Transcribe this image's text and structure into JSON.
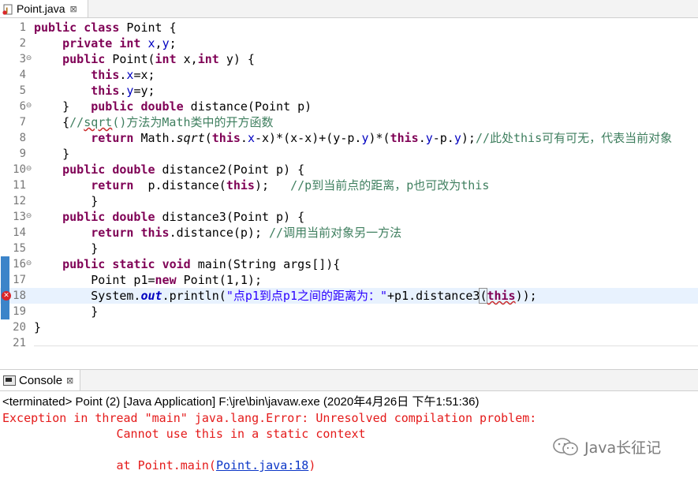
{
  "editor_tab": {
    "title": "Point.java",
    "close": "⊠"
  },
  "code_lines": [
    {
      "n": "1",
      "fold": "",
      "marker": "",
      "current": false,
      "tokens": [
        [
          "kw",
          "public"
        ],
        [
          "",
          " "
        ],
        [
          "kw",
          "class"
        ],
        [
          "",
          " Point {"
        ]
      ]
    },
    {
      "n": "2",
      "fold": "",
      "marker": "",
      "current": false,
      "tokens": [
        [
          "",
          "    "
        ],
        [
          "kw",
          "private"
        ],
        [
          "",
          " "
        ],
        [
          "kw",
          "int"
        ],
        [
          "",
          " "
        ],
        [
          "fld",
          "x"
        ],
        [
          "",
          ","
        ],
        [
          "fld",
          "y"
        ],
        [
          "",
          ";"
        ]
      ]
    },
    {
      "n": "3",
      "fold": "⊖",
      "marker": "",
      "current": false,
      "tokens": [
        [
          "",
          "    "
        ],
        [
          "kw",
          "public"
        ],
        [
          "",
          " Point("
        ],
        [
          "kw",
          "int"
        ],
        [
          "",
          " x,"
        ],
        [
          "kw",
          "int"
        ],
        [
          "",
          " y) {"
        ]
      ]
    },
    {
      "n": "4",
      "fold": "",
      "marker": "",
      "current": false,
      "tokens": [
        [
          "",
          "        "
        ],
        [
          "kw",
          "this"
        ],
        [
          "",
          "."
        ],
        [
          "fld",
          "x"
        ],
        [
          "",
          "=x;"
        ]
      ]
    },
    {
      "n": "5",
      "fold": "",
      "marker": "",
      "current": false,
      "tokens": [
        [
          "",
          "        "
        ],
        [
          "kw",
          "this"
        ],
        [
          "",
          "."
        ],
        [
          "fld",
          "y"
        ],
        [
          "",
          "=y;"
        ]
      ]
    },
    {
      "n": "6",
      "fold": "⊖",
      "marker": "",
      "current": false,
      "tokens": [
        [
          "",
          "    }   "
        ],
        [
          "kw",
          "public"
        ],
        [
          "",
          " "
        ],
        [
          "kw",
          "double"
        ],
        [
          "",
          " distance(Point p)"
        ]
      ]
    },
    {
      "n": "7",
      "fold": "",
      "marker": "",
      "current": false,
      "tokens": [
        [
          "",
          "    {"
        ],
        [
          "cmt",
          "//"
        ],
        [
          "cmt sq",
          "sqrt"
        ],
        [
          "cmt",
          "()方法为Math类中的开方函数"
        ]
      ]
    },
    {
      "n": "8",
      "fold": "",
      "marker": "",
      "current": false,
      "tokens": [
        [
          "",
          "        "
        ],
        [
          "kw",
          "return"
        ],
        [
          "",
          " Math."
        ],
        [
          "ital",
          "sqrt"
        ],
        [
          "",
          "("
        ],
        [
          "kw",
          "this"
        ],
        [
          "",
          "."
        ],
        [
          "fld",
          "x"
        ],
        [
          "",
          "-x)*(x-x)+(y-p."
        ],
        [
          "fld",
          "y"
        ],
        [
          "",
          ")*("
        ],
        [
          "kw",
          "this"
        ],
        [
          "",
          "."
        ],
        [
          "fld",
          "y"
        ],
        [
          "",
          "-p."
        ],
        [
          "fld",
          "y"
        ],
        [
          "",
          ");"
        ],
        [
          "cmt",
          "//此处this可有可无，代表当前对象"
        ]
      ]
    },
    {
      "n": "9",
      "fold": "",
      "marker": "",
      "current": false,
      "tokens": [
        [
          "",
          "    }"
        ]
      ]
    },
    {
      "n": "10",
      "fold": "⊖",
      "marker": "",
      "current": false,
      "tokens": [
        [
          "",
          "    "
        ],
        [
          "kw",
          "public"
        ],
        [
          "",
          " "
        ],
        [
          "kw",
          "double"
        ],
        [
          "",
          " distance2(Point p) {"
        ]
      ]
    },
    {
      "n": "11",
      "fold": "",
      "marker": "",
      "current": false,
      "tokens": [
        [
          "",
          "        "
        ],
        [
          "kw",
          "return"
        ],
        [
          "",
          "  p.distance("
        ],
        [
          "kw",
          "this"
        ],
        [
          "",
          ");   "
        ],
        [
          "cmt",
          "//p到当前点的距离，p也可改为this"
        ]
      ]
    },
    {
      "n": "12",
      "fold": "",
      "marker": "",
      "current": false,
      "tokens": [
        [
          "",
          "        }"
        ]
      ]
    },
    {
      "n": "13",
      "fold": "⊖",
      "marker": "",
      "current": false,
      "tokens": [
        [
          "",
          "    "
        ],
        [
          "kw",
          "public"
        ],
        [
          "",
          " "
        ],
        [
          "kw",
          "double"
        ],
        [
          "",
          " distance3(Point p) {"
        ]
      ]
    },
    {
      "n": "14",
      "fold": "",
      "marker": "",
      "current": false,
      "tokens": [
        [
          "",
          "        "
        ],
        [
          "kw",
          "return"
        ],
        [
          "",
          " "
        ],
        [
          "kw",
          "this"
        ],
        [
          "",
          ".distance(p); "
        ],
        [
          "cmt",
          "//调用当前对象另一方法"
        ]
      ]
    },
    {
      "n": "15",
      "fold": "",
      "marker": "",
      "current": false,
      "tokens": [
        [
          "",
          "        }"
        ]
      ]
    },
    {
      "n": "16",
      "fold": "⊖",
      "marker": "blue",
      "current": false,
      "tokens": [
        [
          "",
          "    "
        ],
        [
          "kw",
          "public"
        ],
        [
          "",
          " "
        ],
        [
          "kw",
          "static"
        ],
        [
          "",
          " "
        ],
        [
          "kw",
          "void"
        ],
        [
          "",
          " main(String args[]){"
        ]
      ]
    },
    {
      "n": "17",
      "fold": "",
      "marker": "blue",
      "current": false,
      "tokens": [
        [
          "",
          "        Point p1="
        ],
        [
          "kw",
          "new"
        ],
        [
          "",
          " Point(1,1);"
        ]
      ]
    },
    {
      "n": "18",
      "fold": "",
      "marker": "error",
      "current": true,
      "tokens": [
        [
          "",
          "        System."
        ],
        [
          "sfld",
          "out"
        ],
        [
          "",
          ".println("
        ],
        [
          "str",
          "\"点p1到点p1之间的距离为：\""
        ],
        [
          "",
          "+p1.distance3"
        ],
        [
          "brk",
          "("
        ],
        [
          "kw sq",
          "this"
        ],
        [
          "",
          "));"
        ]
      ]
    },
    {
      "n": "19",
      "fold": "",
      "marker": "blue",
      "current": false,
      "tokens": [
        [
          "",
          "        }"
        ]
      ]
    },
    {
      "n": "20",
      "fold": "",
      "marker": "",
      "current": false,
      "tokens": [
        [
          "",
          "}"
        ]
      ]
    },
    {
      "n": "21",
      "fold": "",
      "marker": "",
      "current": false,
      "tokens": []
    }
  ],
  "hscroll": {
    "left_arrow": "<"
  },
  "console": {
    "tab_label": "Console",
    "close": "⊠",
    "status": "<terminated> Point (2) [Java Application] F:\\jre\\bin\\javaw.exe (2020年4月26日 下午1:51:36)",
    "line1": "Exception in thread \"main\" java.lang.Error: Unresolved compilation problem: ",
    "line2": "\tCannot use this in a static context",
    "line3": "",
    "line4_prefix": "\tat Point.main(",
    "line4_link": "Point.java:18",
    "line4_suffix": ")"
  },
  "watermark": {
    "text": "Java长征记",
    "icon": "wechat-icon"
  },
  "colors": {
    "keyword": "#7f0055",
    "field": "#0000c0",
    "string": "#2a00ff",
    "comment": "#3f7f5f",
    "error": "#e41a1a",
    "link": "#0c37c7",
    "current_line": "#e8f2fe"
  }
}
